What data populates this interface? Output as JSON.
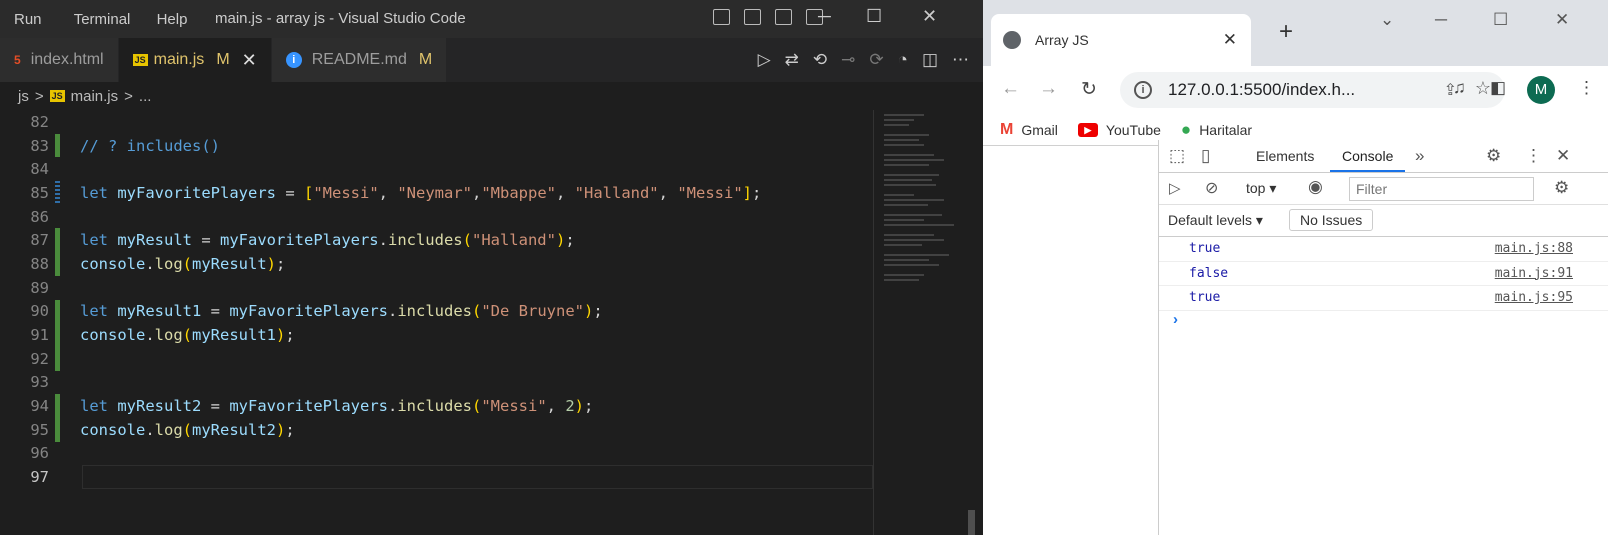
{
  "vscode": {
    "menu": [
      "Run",
      "Terminal",
      "Help"
    ],
    "window_title": "main.js - array js - Visual Studio Code",
    "tabs": [
      {
        "icon": "5",
        "label": "index.html",
        "mod": ""
      },
      {
        "icon": "JS",
        "label": "main.js",
        "mod": "M"
      },
      {
        "icon": "i",
        "label": "README.md",
        "mod": "M"
      }
    ],
    "breadcrumb": [
      "js",
      ">",
      "main.js",
      ">",
      "..."
    ],
    "line_numbers": [
      "82",
      "83",
      "84",
      "85",
      "86",
      "87",
      "88",
      "89",
      "90",
      "91",
      "92",
      "93",
      "94",
      "95",
      "96",
      "97"
    ]
  },
  "chrome": {
    "tab_title": "Array JS",
    "url": "127.0.0.1:5500/index.h...",
    "avatar": "M",
    "bookmarks": [
      "Gmail",
      "YouTube",
      "Haritalar"
    ],
    "devtools": {
      "tabs": [
        "Elements",
        "Console"
      ],
      "context": "top",
      "filter_placeholder": "Filter",
      "levels": "Default levels",
      "issues": "No Issues",
      "logs": [
        {
          "value": "true",
          "source": "main.js:88"
        },
        {
          "value": "false",
          "source": "main.js:91"
        },
        {
          "value": "true",
          "source": "main.js:95"
        }
      ]
    }
  }
}
